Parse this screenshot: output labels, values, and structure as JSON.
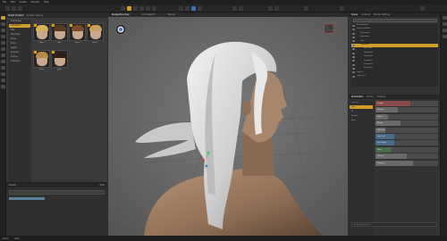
{
  "menubar": {
    "items": [
      "File",
      "Edit",
      "Create",
      "Window",
      "Help"
    ]
  },
  "left_panel": {
    "tabs": [
      "Smart Content",
      "Content Library"
    ],
    "tree": [
      "Characters",
      "Genesis 8",
      "Hair",
      "Wardrobe",
      "Poses",
      "Props",
      "Lights",
      "Shaders",
      "Scenes",
      "Cameras"
    ],
    "selected_tree_index": 1,
    "thumbnails": [
      "Aiko",
      "Ava",
      "Bree",
      "Darcy",
      "Elise",
      "Jade"
    ],
    "lower_title": "Presets",
    "lower_action": "Filter"
  },
  "viewport": {
    "tabs": [
      "Perspective View",
      "Aux Viewport",
      "Render"
    ],
    "active_tab_index": 0
  },
  "right_panel": {
    "tabs": [
      "Scene",
      "Surfaces",
      "Render Settings"
    ],
    "scene_items": [
      "Environment",
      "Genesis 8 Male",
      "Eyebrows",
      "Eyelashes",
      "Tear",
      "Long Hair",
      "Hair Cap",
      "Strands A",
      "Strands B",
      "Strands C",
      "Strands D",
      "Strands E",
      "Light 1",
      "Camera 1"
    ],
    "selected_scene_index": 5,
    "param_tabs": [
      "Parameters",
      "Posing",
      "Shaping"
    ],
    "param_groups": [
      "General",
      "Hair",
      "Fit",
      "Morphs",
      "Actor"
    ],
    "selected_param_group": 1,
    "params": [
      {
        "name": "Length",
        "fill": 0.55,
        "color": "#8a4a4a"
      },
      {
        "name": "Volume",
        "fill": 0.35,
        "color": "#6a6a6a"
      },
      {
        "name": "Wave",
        "fill": 0.2,
        "color": "#6a6a6a"
      },
      {
        "name": "Bangs",
        "fill": 0.4,
        "color": "#6a6a6a"
      },
      {
        "name": "Side Part",
        "fill": 0.15,
        "color": "#6a6a6a"
      },
      {
        "name": "Tuck Left",
        "fill": 0.3,
        "color": "#4a6a8a"
      },
      {
        "name": "Tuck Right",
        "fill": 0.3,
        "color": "#4a6a8a"
      },
      {
        "name": "Wind",
        "fill": 0.25,
        "color": "#4a6a4a"
      },
      {
        "name": "Gravity",
        "fill": 0.5,
        "color": "#6a6a6a"
      },
      {
        "name": "Ponytail",
        "fill": 0.6,
        "color": "#6a6a6a"
      }
    ],
    "bottom_field": "Search parameters"
  },
  "colors": {
    "accent": "#d39d2a",
    "viewport_bg": "#6a6a6a",
    "panel": "#333333"
  },
  "status": {
    "left": "Ready",
    "right": "100%"
  }
}
